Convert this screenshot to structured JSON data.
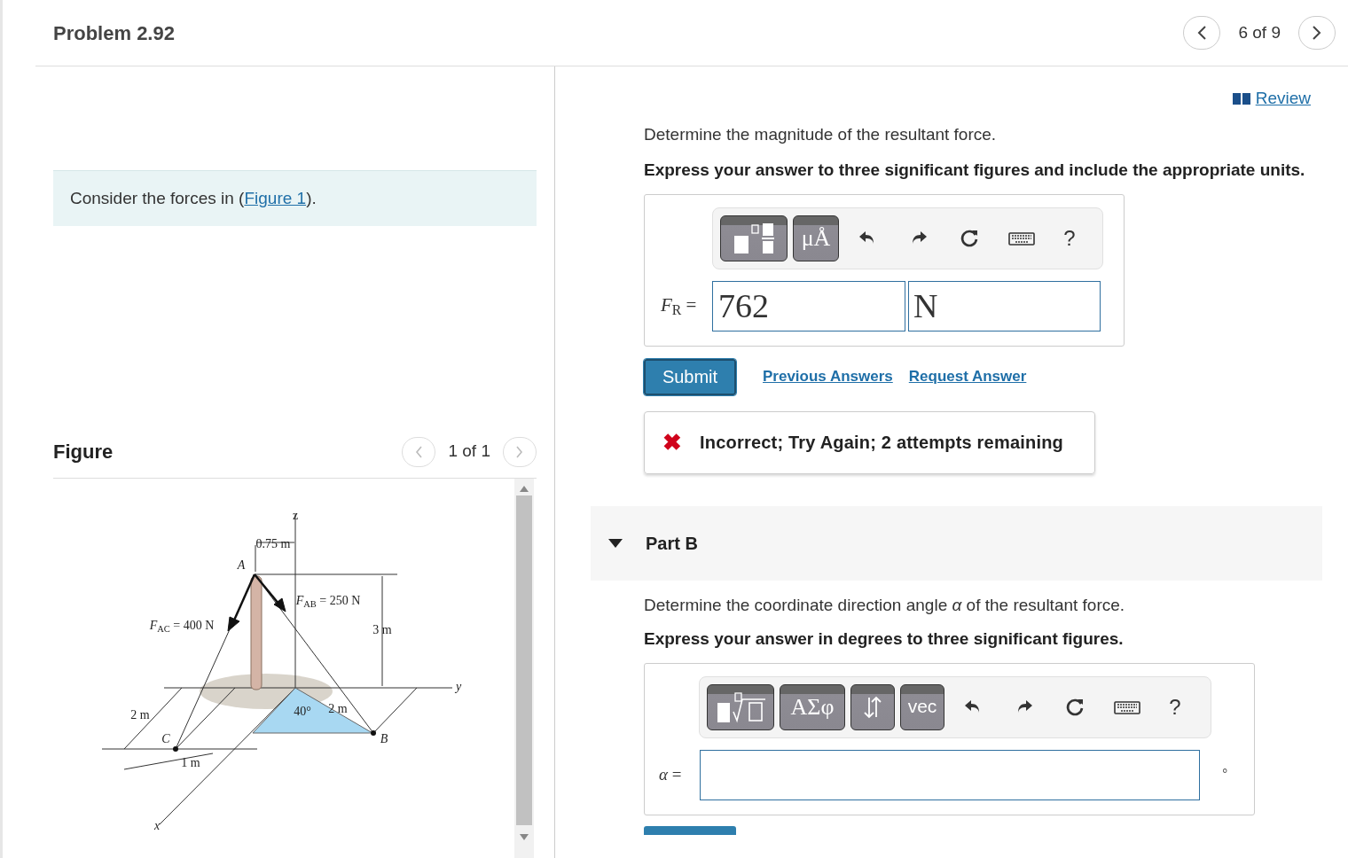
{
  "header": {
    "title": "Problem 2.92",
    "position": "6 of 9"
  },
  "intro": {
    "text": "Consider the forces in (",
    "link": "Figure 1",
    "after": ")."
  },
  "figure": {
    "title": "Figure",
    "pager": "1 of 1",
    "labels": [
      "z",
      "0.75 m",
      "*A*",
      "*F*$_{AB}$ = 250 N",
      "*F*$_{AC}$ = 400 N",
      "3 m",
      "*y*",
      "2 m",
      "40°",
      "2 m",
      "*C*",
      "*B*",
      "1 m",
      "*x*"
    ]
  },
  "review": "Review",
  "part_a": {
    "question": "Determine the magnitude of the resultant force.",
    "instruction": "Express your answer to three significant figures and include the appropriate units.",
    "toolbar": [
      {
        "kind": "templates"
      },
      {
        "kind": "label",
        "label": "μÅ"
      },
      {
        "kind": "undo"
      },
      {
        "kind": "redo"
      },
      {
        "kind": "reset"
      },
      {
        "kind": "keyboard"
      },
      {
        "kind": "text",
        "label": "?"
      }
    ],
    "variable": "*F*$_{R}$ =",
    "value": "762",
    "unit": "N",
    "actions": {
      "submit": "Submit",
      "links": [
        "Previous Answers",
        "Request Answer"
      ]
    },
    "feedback": {
      "icon": "✖",
      "text": "Incorrect; Try Again; 2 attempts remaining"
    }
  },
  "part_b": {
    "title": "Part B",
    "expanded": true,
    "question": "Determine the coordinate direction angle *α* of the resultant force.",
    "instruction": "Express your answer in degrees to three significant figures.",
    "toolbar": [
      {
        "kind": "root"
      },
      {
        "kind": "label",
        "label": "ΑΣφ"
      },
      {
        "kind": "arrows"
      },
      {
        "kind": "label",
        "label": "vec"
      },
      {
        "kind": "undo"
      },
      {
        "kind": "redo"
      },
      {
        "kind": "reset"
      },
      {
        "kind": "keyboard"
      },
      {
        "kind": "text",
        "label": "?"
      }
    ],
    "variable": "*α* =",
    "unit": "°"
  }
}
